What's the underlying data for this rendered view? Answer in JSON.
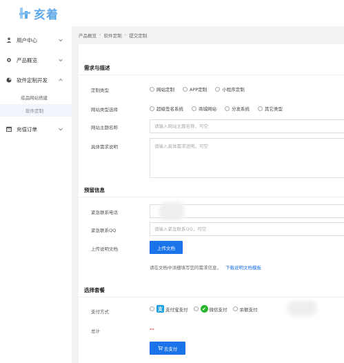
{
  "app": {
    "logo_text": "亥着"
  },
  "sidebar": {
    "items": [
      {
        "label": "用户中心",
        "icon": "user-icon"
      },
      {
        "label": "产品概览",
        "icon": "gear-icon"
      },
      {
        "label": "软件定制开发",
        "icon": "circle-pie-icon"
      },
      {
        "label": "充值订单",
        "icon": "calendar-icon"
      }
    ],
    "sub_items": [
      {
        "label": "成品网站搭建"
      },
      {
        "label": "软件定制"
      }
    ]
  },
  "breadcrumb": [
    "产品概览",
    "软件定制",
    "提交定制"
  ],
  "sections": {
    "requirements": {
      "title": "需求与描述",
      "custom_type": {
        "label": "定制类型",
        "options": [
          "网站定制",
          "APP定制",
          "小程序定制"
        ]
      },
      "site_type": {
        "label": "网站类型选择",
        "options": [
          "超级签名系统",
          "商城网站",
          "分发系统",
          "其它类型"
        ]
      },
      "site_theme": {
        "label": "网站主题名称",
        "placeholder": "请输入网站主题名称，可空"
      },
      "detail": {
        "label": "具体需求说明",
        "placeholder": "请输入具体需求说明，可空"
      }
    },
    "contact": {
      "title": "预留信息",
      "phone": {
        "label": "紧急联系电话"
      },
      "qq": {
        "label": "紧急联系QQ",
        "placeholder": "请输入紧急联系QQ，可空"
      },
      "upload": {
        "label": "上传说明文档",
        "button": "上传文档"
      },
      "hint": "请在文档中详细填写您的需求信息，",
      "hint_link": "下载说明文档模板"
    },
    "package": {
      "title": "选择套餐",
      "pay_method": {
        "label": "支付方式",
        "options": [
          "支付宝支付",
          "微信支付",
          "余额支付"
        ]
      },
      "total": {
        "label": "总计",
        "value": "--"
      },
      "pay_button": "去支付"
    }
  }
}
